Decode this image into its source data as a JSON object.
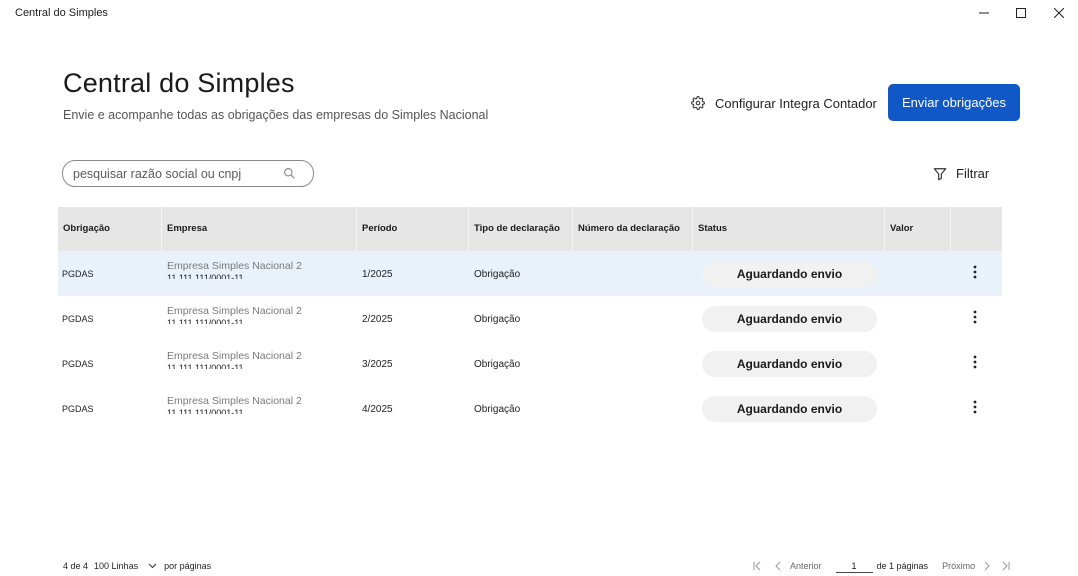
{
  "window": {
    "title": "Central do Simples",
    "controls": [
      "minimize-icon",
      "maximize-icon",
      "close-icon"
    ]
  },
  "header": {
    "title": "Central do Simples",
    "subtitle": "Envie e acompanhe todas as obrigações das empresas do Simples Nacional",
    "config_label": "Configurar Integra Contador",
    "config_icon": "gear-icon",
    "primary_label": "Enviar obrigações",
    "primary_color": "#0f58c6"
  },
  "search": {
    "placeholder": "pesquisar razão social ou cnpj",
    "value": "",
    "icon": "search-icon"
  },
  "filter": {
    "label": "Filtrar",
    "icon": "filter-icon"
  },
  "table": {
    "columns": [
      "Obrigação",
      "Empresa",
      "Período",
      "Tipo de declaração",
      "Número da declaração",
      "Status",
      "Valor"
    ],
    "rows": [
      {
        "obrigacao": "PGDAS",
        "empresa": "Empresa Simples Nacional 2",
        "cnpj": "11.111.111/0001-11",
        "periodo": "1/2025",
        "tipo": "Obrigação",
        "numero": "",
        "status": "Aguardando envio",
        "valor": "",
        "selected": true
      },
      {
        "obrigacao": "PGDAS",
        "empresa": "Empresa Simples Nacional 2",
        "cnpj": "11.111.111/0001-11",
        "periodo": "2/2025",
        "tipo": "Obrigação",
        "numero": "",
        "status": "Aguardando envio",
        "valor": "",
        "selected": false
      },
      {
        "obrigacao": "PGDAS",
        "empresa": "Empresa Simples Nacional 2",
        "cnpj": "11.111.111/0001-11",
        "periodo": "3/2025",
        "tipo": "Obrigação",
        "numero": "",
        "status": "Aguardando envio",
        "valor": "",
        "selected": false
      },
      {
        "obrigacao": "PGDAS",
        "empresa": "Empresa Simples Nacional 2",
        "cnpj": "11.111.111/0001-11",
        "periodo": "4/2025",
        "tipo": "Obrigação",
        "numero": "",
        "status": "Aguardando envio",
        "valor": "",
        "selected": false
      }
    ]
  },
  "footer": {
    "count": "4 de 4",
    "rows_per_page": "100 Linhas",
    "per_page_label": "por páginas",
    "prev_label": "Anterior",
    "current_page": "1",
    "of_pages": "de 1 páginas",
    "next_label": "Próximo"
  }
}
